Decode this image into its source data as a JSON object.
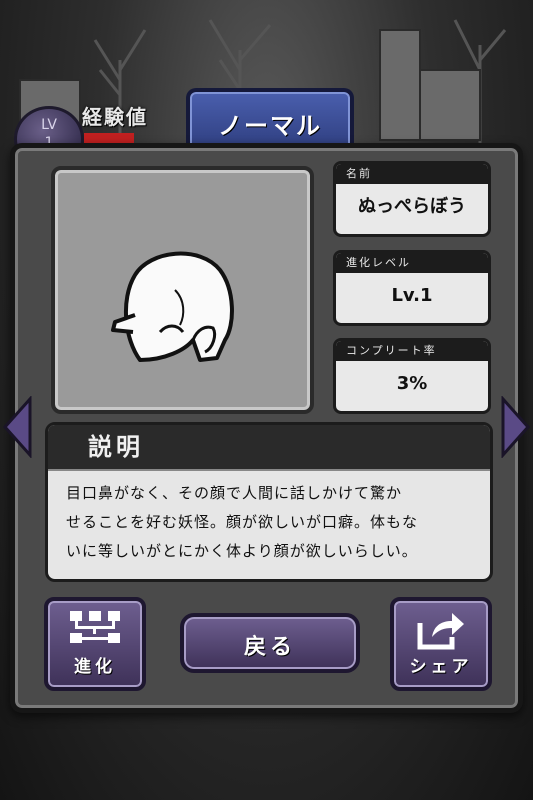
{
  "header": {
    "level_label": "LV",
    "level_value": "1",
    "exp_label": "経験値",
    "rarity_tab": "ノーマル"
  },
  "yokai": {
    "name_label": "名前",
    "name_value": "ぬっぺらぼう",
    "evolution_label": "進化レベル",
    "evolution_value": "Lv.1",
    "completion_label": "コンプリート率",
    "completion_value": "3%"
  },
  "description": {
    "heading": "説明",
    "line1": "目口鼻がなく、その顔で人間に話しかけて驚か",
    "line2": "せることを好む妖怪。顔が欲しいが口癖。体もな",
    "line3": "いに等しいがとにかく体より顔が欲しいらしい。"
  },
  "buttons": {
    "evolve": "進化",
    "back": "戻る",
    "share": "シェア"
  },
  "colors": {
    "panel": "#4a4a4a",
    "rarity_tab": "#3c4c94",
    "button": "#5a4a7a",
    "exp_bar": "#c02020"
  },
  "icons": {
    "evolve": "evolution-tree-icon",
    "share": "share-arrow-icon",
    "prev": "arrow-left-icon",
    "next": "arrow-right-icon"
  }
}
